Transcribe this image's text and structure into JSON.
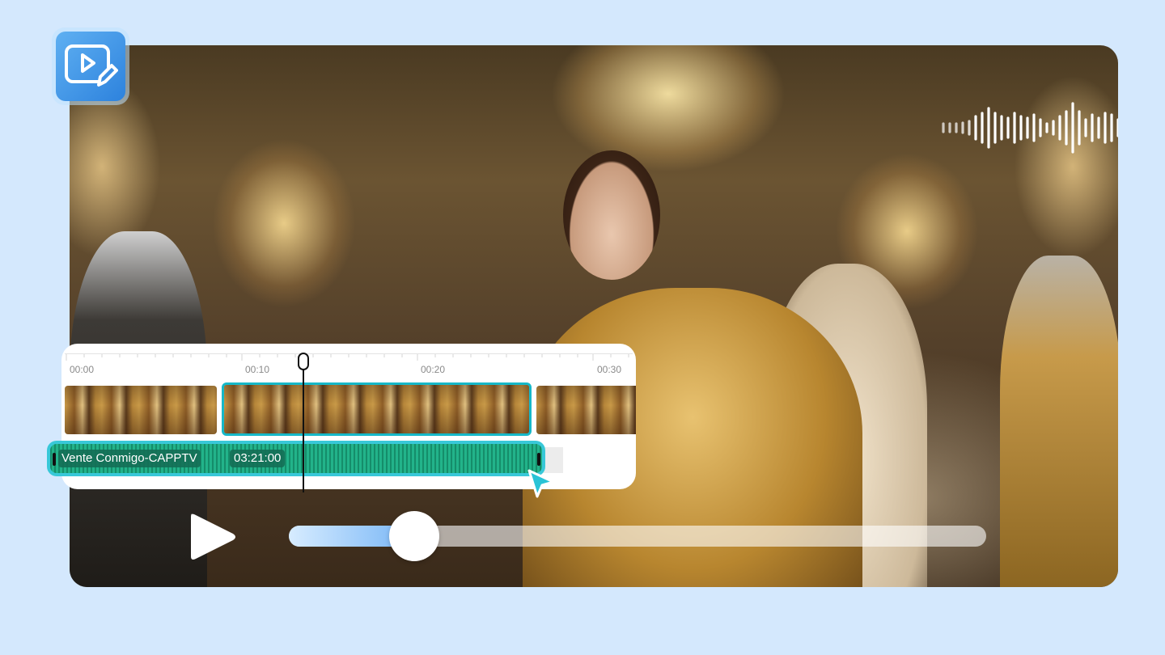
{
  "app_icon": {
    "name": "video-edit-icon",
    "color": "#2d82dd"
  },
  "sound_wave": {
    "name": "audio-waveform-icon",
    "color": "#ffffff"
  },
  "timeline": {
    "ticks": [
      "00:00",
      "00:10",
      "00:20",
      "00:30"
    ],
    "audio_clip": {
      "title": "Vente Conmigo-CAPPTV",
      "duration": "03:21:00",
      "color": "#22b38a"
    },
    "selection_color": "#16b8c8"
  },
  "player": {
    "play_icon": "play-icon",
    "progress_percent": 18,
    "accent": "#63aaf4"
  }
}
